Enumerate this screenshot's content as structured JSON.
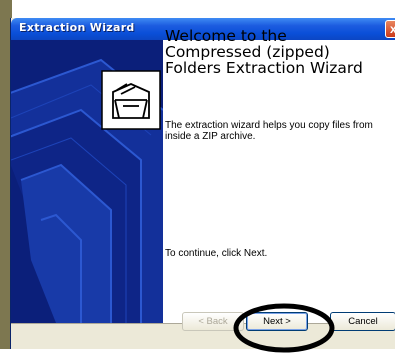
{
  "window": {
    "title": "Extraction Wizard",
    "close_label": "x"
  },
  "content": {
    "heading": "Welcome to the Compressed (zipped) Folders Extraction Wizard",
    "description": "The extraction wizard helps you copy files from inside a ZIP archive.",
    "continue_text": "To continue, click Next."
  },
  "buttons": {
    "back": "< Back",
    "next": "Next >",
    "cancel": "Cancel"
  },
  "icons": {
    "wizard": "zipped-folder-icon",
    "close": "close-icon"
  },
  "colors": {
    "titlebar": "#0a4fd8",
    "side_panel": "#0b1f7a",
    "annotation": "#000000"
  }
}
